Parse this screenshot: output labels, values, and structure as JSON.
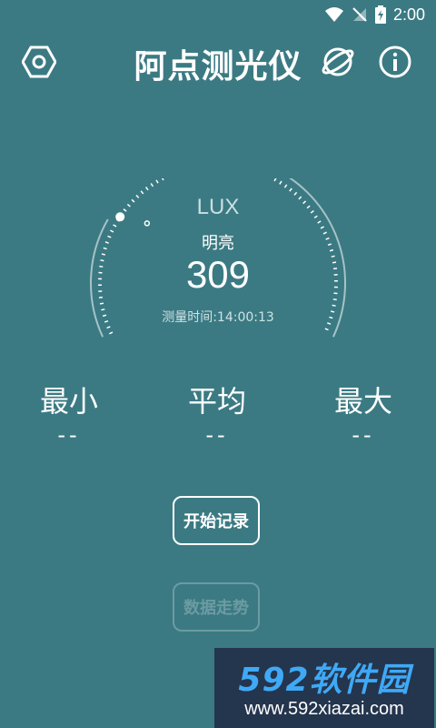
{
  "status_bar": {
    "time": "2:00"
  },
  "toolbar": {
    "title": "阿点测光仪"
  },
  "gauge": {
    "unit": "LUX",
    "level": "明亮",
    "value": "309",
    "time_label": "测量时间:14:00:13"
  },
  "stats": {
    "min": {
      "label": "最小",
      "value": "--"
    },
    "avg": {
      "label": "平均",
      "value": "--"
    },
    "max": {
      "label": "最大",
      "value": "--"
    }
  },
  "buttons": {
    "start": "开始记录",
    "trend": "数据走势"
  },
  "watermark": {
    "brand": "592软件园",
    "url": "www.592xiazai.com"
  }
}
